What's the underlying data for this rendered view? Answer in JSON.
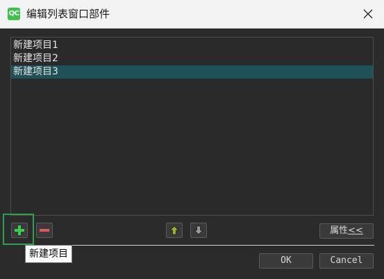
{
  "window": {
    "title": "编辑列表窗口部件",
    "app_icon_text": "QC",
    "close_icon": "close-icon"
  },
  "list": {
    "items": [
      {
        "label": "新建项目1",
        "selected": false
      },
      {
        "label": "新建项目2",
        "selected": false
      },
      {
        "label": "新建项目3",
        "selected": true
      }
    ]
  },
  "toolbar": {
    "add_icon": "plus-icon",
    "remove_icon": "minus-icon",
    "move_up_icon": "arrow-up-icon",
    "move_down_icon": "arrow-down-icon",
    "properties_label": "属性",
    "properties_suffix": "<<"
  },
  "tooltip": {
    "text": "新建项目"
  },
  "dialog_buttons": {
    "ok_label": "OK",
    "cancel_label": "Cancel"
  },
  "colors": {
    "background": "#2b2b2b",
    "selection": "#1e5158",
    "add_green": "#37d24a",
    "remove_red": "#e0555f",
    "arrow_up_olive": "#a3b020",
    "arrow_down_gray": "#9a9a9a",
    "focus_green": "#2aa34a"
  }
}
